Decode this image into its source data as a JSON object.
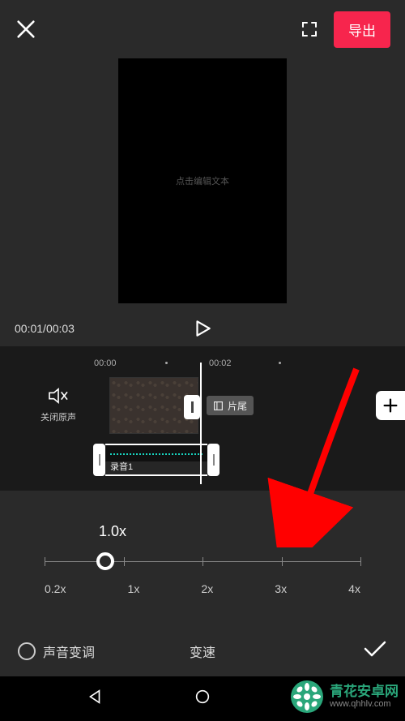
{
  "colors": {
    "accent": "#f7254d",
    "teal": "#18d5c0",
    "wm_green": "#2aa67a"
  },
  "topbar": {
    "export_label": "导出"
  },
  "preview": {
    "hint": "点击编辑文本"
  },
  "playback": {
    "current_time": "00:01",
    "total_time": "00:03"
  },
  "ruler": {
    "marks": [
      "00:00",
      "00:02"
    ]
  },
  "tracks": {
    "mute_label": "关闭原声",
    "tail_label": "片尾",
    "audio_clip_label": "录音1"
  },
  "speed": {
    "current_value": "1.0x",
    "ticks": [
      "0.2x",
      "1x",
      "2x",
      "3x",
      "4x"
    ]
  },
  "actionbar": {
    "pitch_toggle_label": "声音变调",
    "title": "变速"
  },
  "watermark": {
    "line1": "青花安卓网",
    "line2": "www.qhhlv.com"
  }
}
